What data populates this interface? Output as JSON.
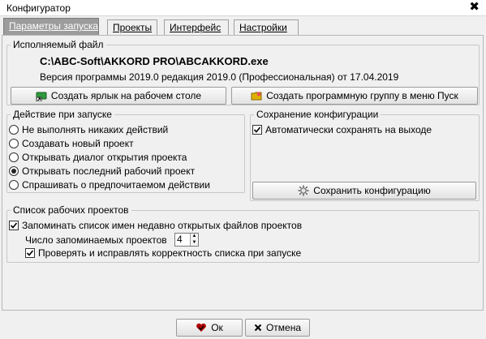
{
  "window": {
    "title": "Конфигуратор",
    "close_glyph": "✖"
  },
  "tabs": [
    {
      "label": "Параметры запуска",
      "active": true
    },
    {
      "label": "Проекты",
      "active": false
    },
    {
      "label": "Интерфейс",
      "active": false
    },
    {
      "label": "Настройки",
      "active": false
    }
  ],
  "executable": {
    "legend": "Исполняемый файл",
    "path": "C:\\ABC-Soft\\AKKORD PRO\\ABCAKKORD.exe",
    "version": "Версия программы 2019.0 редакция 2019.0 (Профессиональная) от 17.04.2019",
    "shortcut_button": "Создать ярлык на рабочем столе",
    "group_button": "Создать программную группу в меню Пуск"
  },
  "startup_action": {
    "legend": "Действие при запуске",
    "options": [
      {
        "label": "Не выполнять никаких действий",
        "selected": false
      },
      {
        "label": "Создавать новый проект",
        "selected": false
      },
      {
        "label": "Открывать диалог открытия проекта",
        "selected": false
      },
      {
        "label": "Открывать последний рабочий проект",
        "selected": true
      },
      {
        "label": "Спрашивать о предпочитаемом действии",
        "selected": false
      }
    ]
  },
  "save_config": {
    "legend": "Сохранение конфигурации",
    "auto_save_label": "Автоматически сохранять на выходе",
    "auto_save_checked": true,
    "save_button": "Сохранить конфигурацию"
  },
  "projects_list": {
    "legend": "Список рабочих проектов",
    "remember_label": "Запоминать список имен недавно открытых файлов проектов",
    "remember_checked": true,
    "count_label": "Число запоминаемых проектов",
    "count_value": "4",
    "verify_label": "Проверять и исправлять корректность списка при запуске",
    "verify_checked": true
  },
  "footer": {
    "ok_label": "Ок",
    "cancel_label": "Отмена"
  },
  "colors": {
    "active_tab": "#9c9c9c",
    "ok_icon": "#b00000",
    "group_icon": "#e0b000",
    "shortcut_icon": "#2e9a3e"
  }
}
